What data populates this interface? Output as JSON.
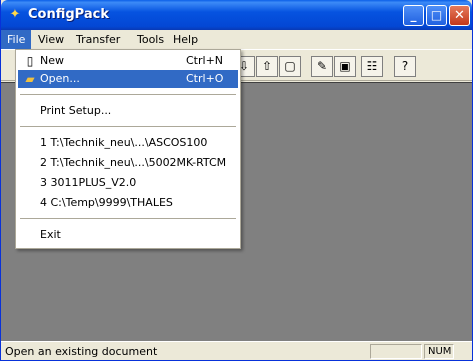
{
  "window": {
    "title": "ConfigPack",
    "app_icon": "configpack-app-icon"
  },
  "titlebar_buttons": {
    "minimize": "_",
    "maximize": "□",
    "close": "✕"
  },
  "menubar": {
    "items": [
      {
        "label": "File"
      },
      {
        "label": "View"
      },
      {
        "label": "Transfer"
      },
      {
        "label": "Tools"
      },
      {
        "label": "Help"
      }
    ]
  },
  "file_menu": {
    "new": {
      "label": "New",
      "shortcut": "Ctrl+N",
      "icon": "new-document-icon"
    },
    "open": {
      "label": "Open...",
      "shortcut": "Ctrl+O",
      "icon": "open-folder-icon"
    },
    "print_setup": {
      "label": "Print Setup..."
    },
    "recent": [
      {
        "label": "1 T:\\Technik_neu\\...\\ASCOS100"
      },
      {
        "label": "2 T:\\Technik_neu\\...\\5002MK-RTCM"
      },
      {
        "label": "3 3011PLUS_V2.0"
      },
      {
        "label": "4 C:\\Temp\\9999\\THALES"
      }
    ],
    "exit": {
      "label": "Exit"
    }
  },
  "toolbar": {
    "buttons": [
      {
        "icon": "download-icon",
        "glyph": "⇩"
      },
      {
        "icon": "upload-icon",
        "glyph": "⇧"
      },
      {
        "icon": "copy-icon",
        "glyph": "▢"
      },
      {
        "icon": "edit-icon",
        "glyph": "✎"
      },
      {
        "icon": "image-icon",
        "glyph": "▣"
      },
      {
        "icon": "properties-icon",
        "glyph": "☷"
      },
      {
        "icon": "help-icon",
        "glyph": "?"
      }
    ]
  },
  "statusbar": {
    "text": "Open an existing document",
    "num": "NUM"
  },
  "colors": {
    "titlebar": "#0653e0",
    "highlight": "#316ac5",
    "client": "#808080"
  }
}
